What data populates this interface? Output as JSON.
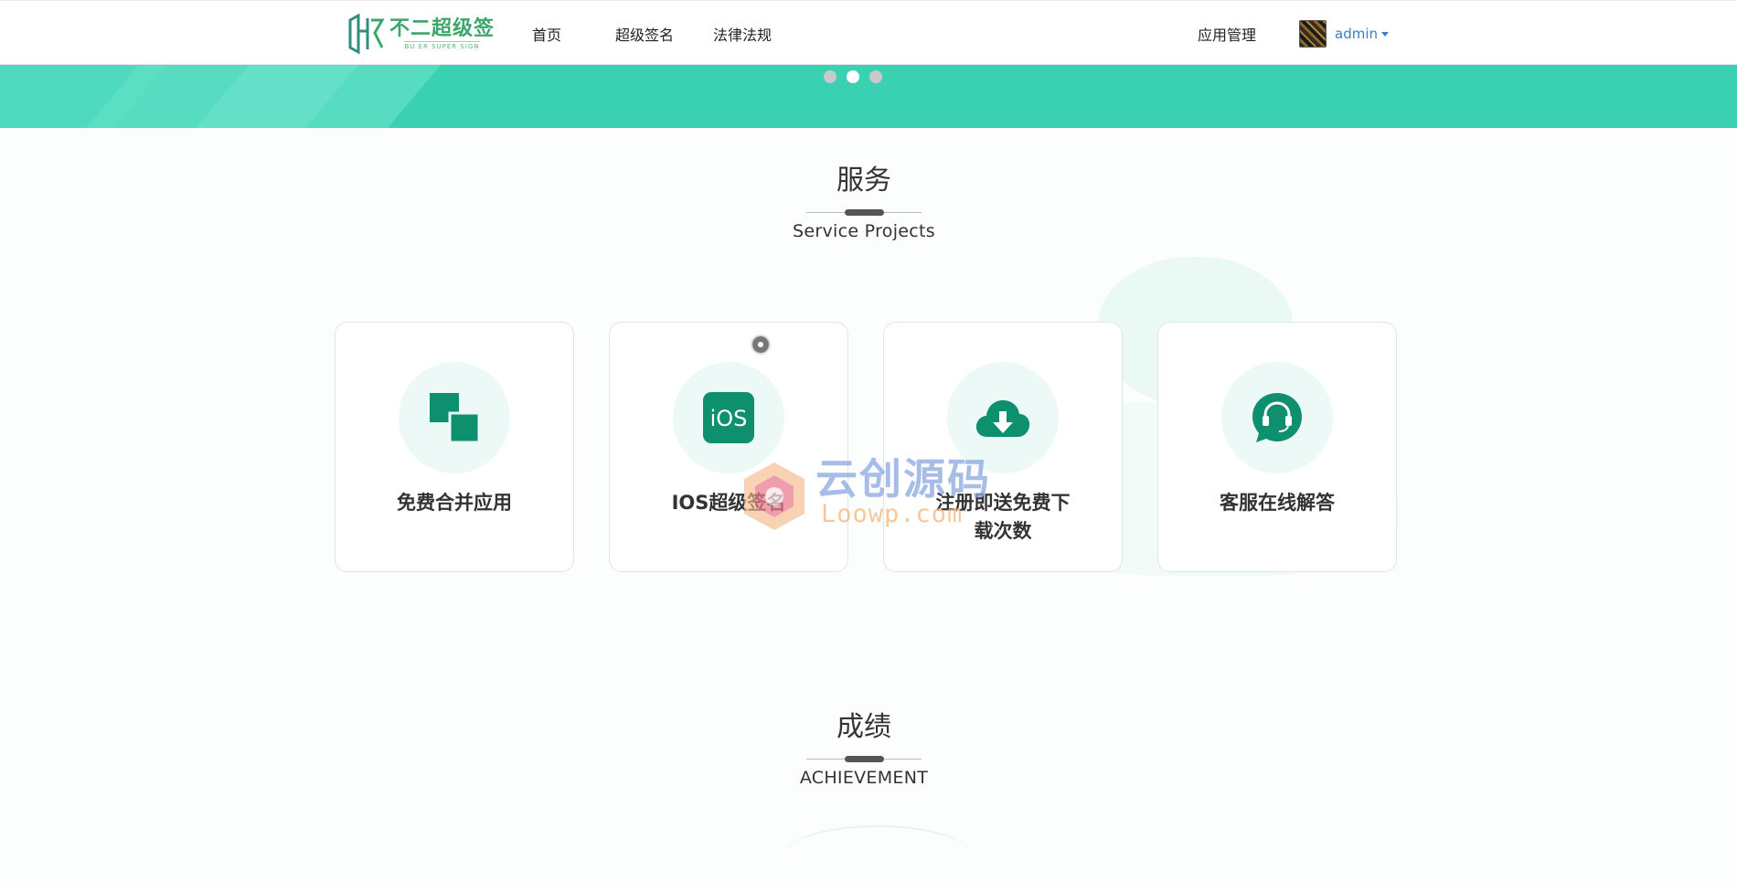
{
  "brand": {
    "name": "不二超级签",
    "subtitle": "BU ER SUPER SIGN"
  },
  "nav": {
    "home": "首页",
    "super_sign": "超级签名",
    "legal": "法律法规"
  },
  "header": {
    "app_management": "应用管理",
    "username": "admin"
  },
  "carousel": {
    "slide_count": 3,
    "active_index": 1
  },
  "services": {
    "title": "服务",
    "subtitle": "Service Projects",
    "items": [
      {
        "label": "免费合并应用",
        "icon": "merge-apps-icon"
      },
      {
        "label": "IOS超级签名",
        "icon": "ios-icon",
        "icon_text": "iOS"
      },
      {
        "label": "注册即送免费下载次数",
        "icon": "cloud-download-icon"
      },
      {
        "label": "客服在线解答",
        "icon": "headset-chat-icon"
      }
    ]
  },
  "achievement": {
    "title": "成绩",
    "subtitle": "ACHIEVEMENT"
  },
  "watermark": {
    "cn": "云创源码",
    "en": "Loowp.com"
  },
  "colors": {
    "brand_green": "#3ea66a",
    "banner": "#3ad1b3",
    "icon_green": "#0e8f6e",
    "link_blue": "#3a7ec4"
  }
}
